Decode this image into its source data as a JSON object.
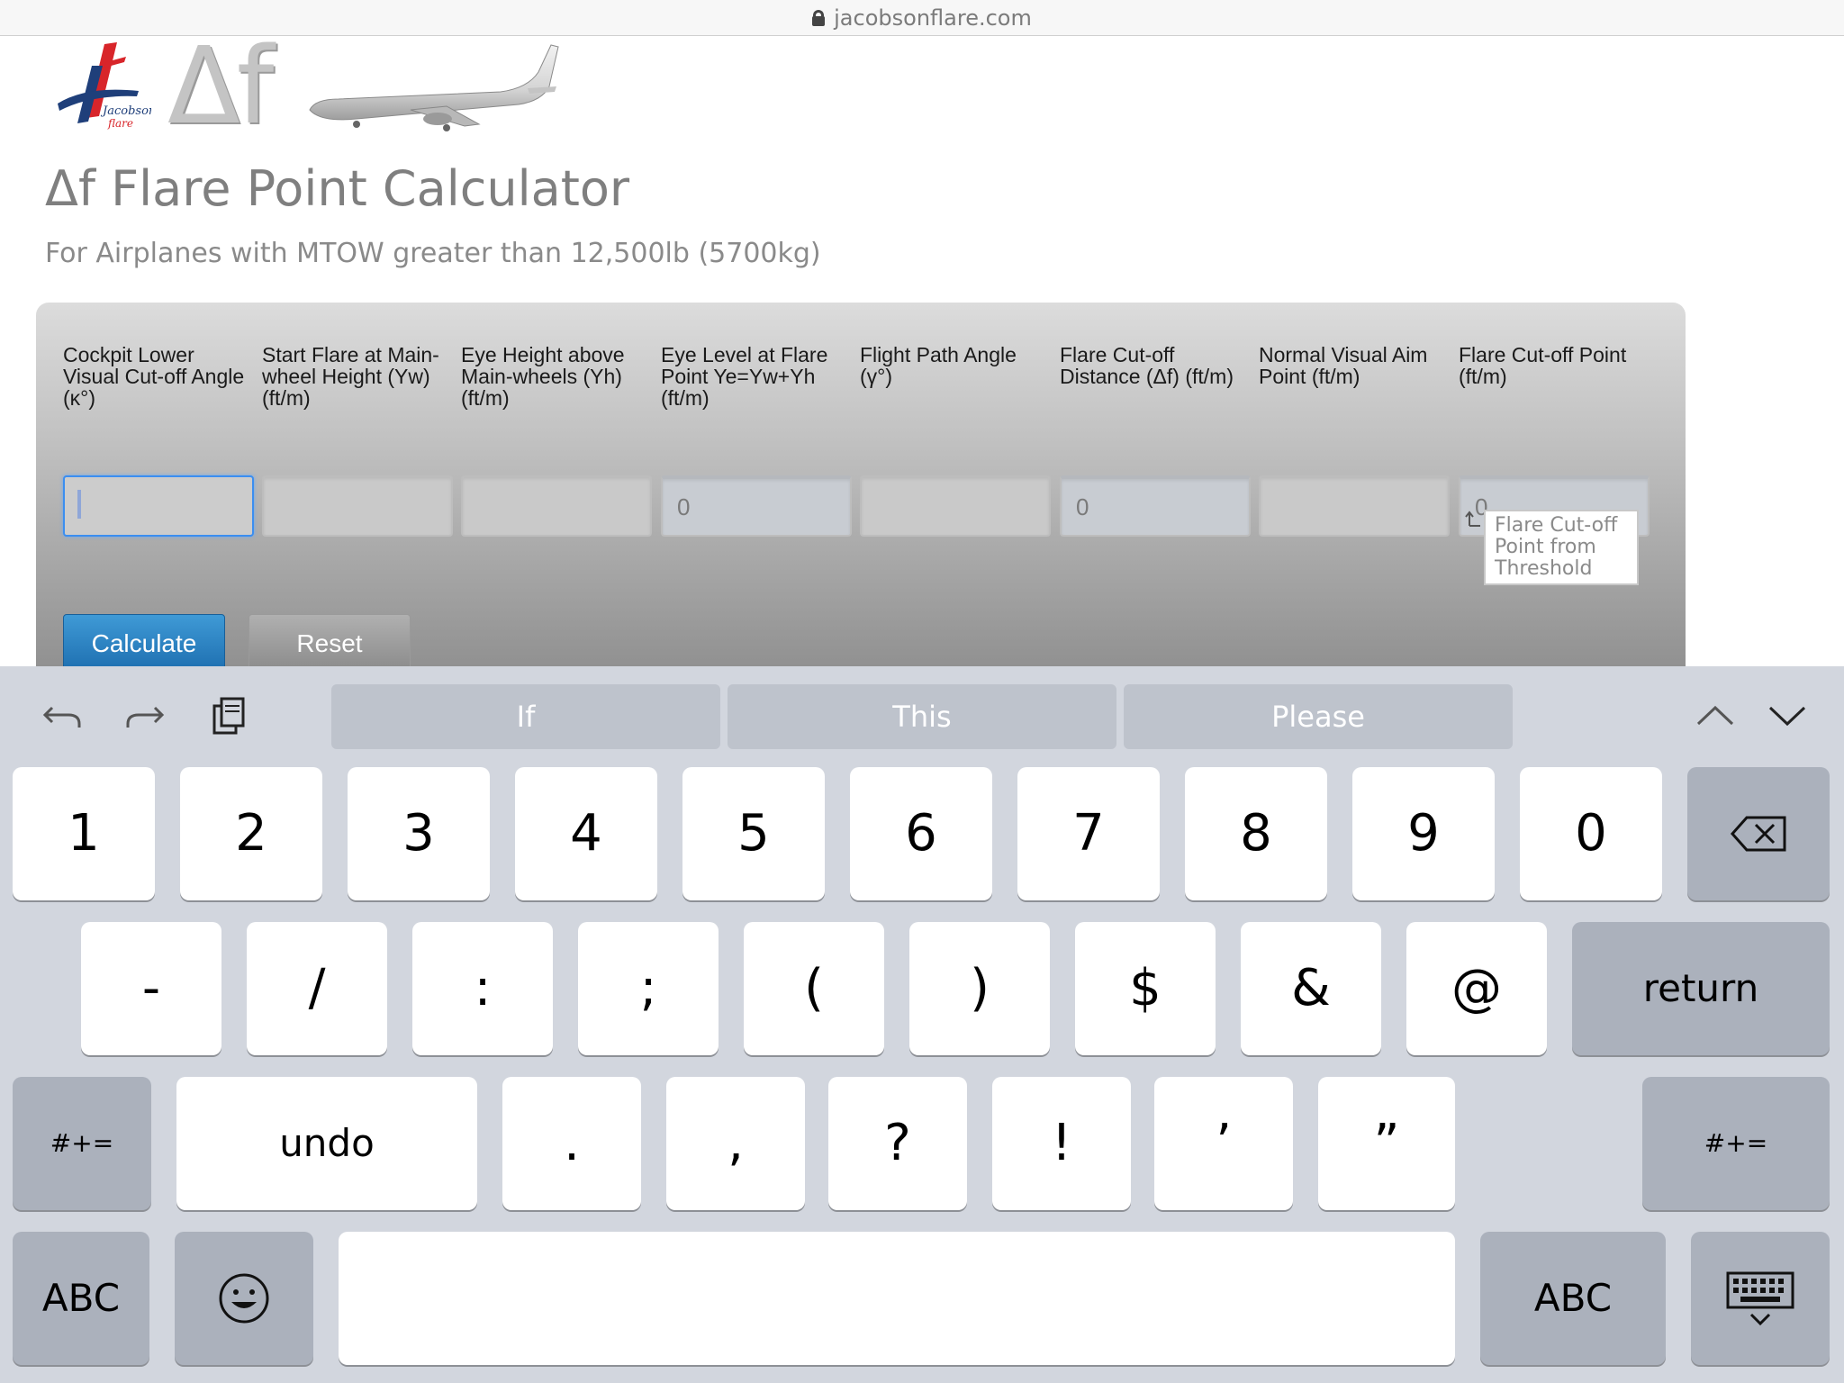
{
  "browser": {
    "url": "jacobsonflare.com"
  },
  "header": {
    "logo_text": "Jacobson flare",
    "delta_f": "Δf"
  },
  "page": {
    "title": "Δf Flare Point Calculator",
    "subtitle": "For Airplanes with MTOW greater than 12,500lb (5700kg)"
  },
  "calculator": {
    "columns": [
      {
        "label": "Cockpit Lower Visual Cut-off Angle (κ°)",
        "value": "",
        "readonly": false,
        "focused": true
      },
      {
        "label": "Start Flare at Main-wheel Height (Yw) (ft/m)",
        "value": "",
        "readonly": false
      },
      {
        "label": "Eye Height above Main-wheels (Yh) (ft/m)",
        "value": "",
        "readonly": false
      },
      {
        "label": "Eye Level at Flare Point Ye=Yw+Yh (ft/m)",
        "value": "0",
        "readonly": true
      },
      {
        "label": "Flight Path Angle (γ°)",
        "value": "",
        "readonly": false
      },
      {
        "label": "Flare Cut-off Distance (Δf) (ft/m)",
        "value": "0",
        "readonly": true
      },
      {
        "label": "Normal Visual Aim Point (ft/m)",
        "value": "",
        "readonly": false
      },
      {
        "label": "Flare Cut-off Point (ft/m)",
        "value": "0",
        "readonly": true
      }
    ],
    "tooltip": "Flare Cut-off Point from Threshold",
    "calculate_label": "Calculate",
    "reset_label": "Reset"
  },
  "keyboard": {
    "suggestions": [
      "If",
      "This",
      "Please"
    ],
    "row1": [
      "1",
      "2",
      "3",
      "4",
      "5",
      "6",
      "7",
      "8",
      "9",
      "0"
    ],
    "row2": [
      "-",
      "/",
      ":",
      ";",
      "(",
      ")",
      "$",
      "&",
      "@"
    ],
    "return_label": "return",
    "row3": [
      ".",
      ",",
      "?",
      "!",
      "’",
      "”"
    ],
    "undo_label": "undo",
    "symbols_label": "#+=",
    "abc_label": "ABC"
  }
}
